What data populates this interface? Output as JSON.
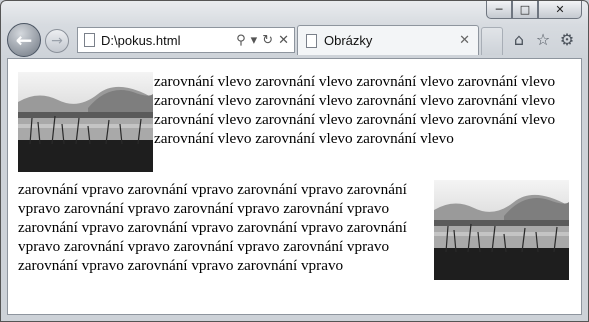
{
  "browser": {
    "address_url": "D:\\pokus.html",
    "tab_title": "Obrázky",
    "caption_buttons": {
      "minimize": "─",
      "maximize": "□",
      "close": "✕"
    },
    "icons": {
      "back": "back-arrow-icon",
      "forward": "forward-arrow-icon",
      "search": "search-icon",
      "refresh": "refresh-icon",
      "stop": "stop-icon",
      "home": "home-icon",
      "favorites": "star-icon",
      "tools": "gear-icon"
    }
  },
  "content": {
    "left_paragraph": "zarovnání vlevo zarovnání vlevo zarovnání vlevo zarovnání vlevo zarovnání vlevo zarovnání vlevo zarovnání vlevo zarovnání vlevo zarovnání vlevo zarovnání vlevo zarovnání vlevo zarovnání vlevo zarovnání vlevo zarovnání vlevo zarovnání vlevo",
    "right_paragraph": "zarovnání vpravo zarovnání vpravo zarovnání vpravo zarovnání vpravo zarovnání vpravo zarovnání vpravo zarovnání vpravo zarovnání vpravo zarovnání vpravo zarovnání vpravo zarovnání vpravo zarovnání vpravo zarovnání vpravo zarovnání vpravo zarovnání vpravo zarovnání vpravo zarovnání vpravo"
  }
}
